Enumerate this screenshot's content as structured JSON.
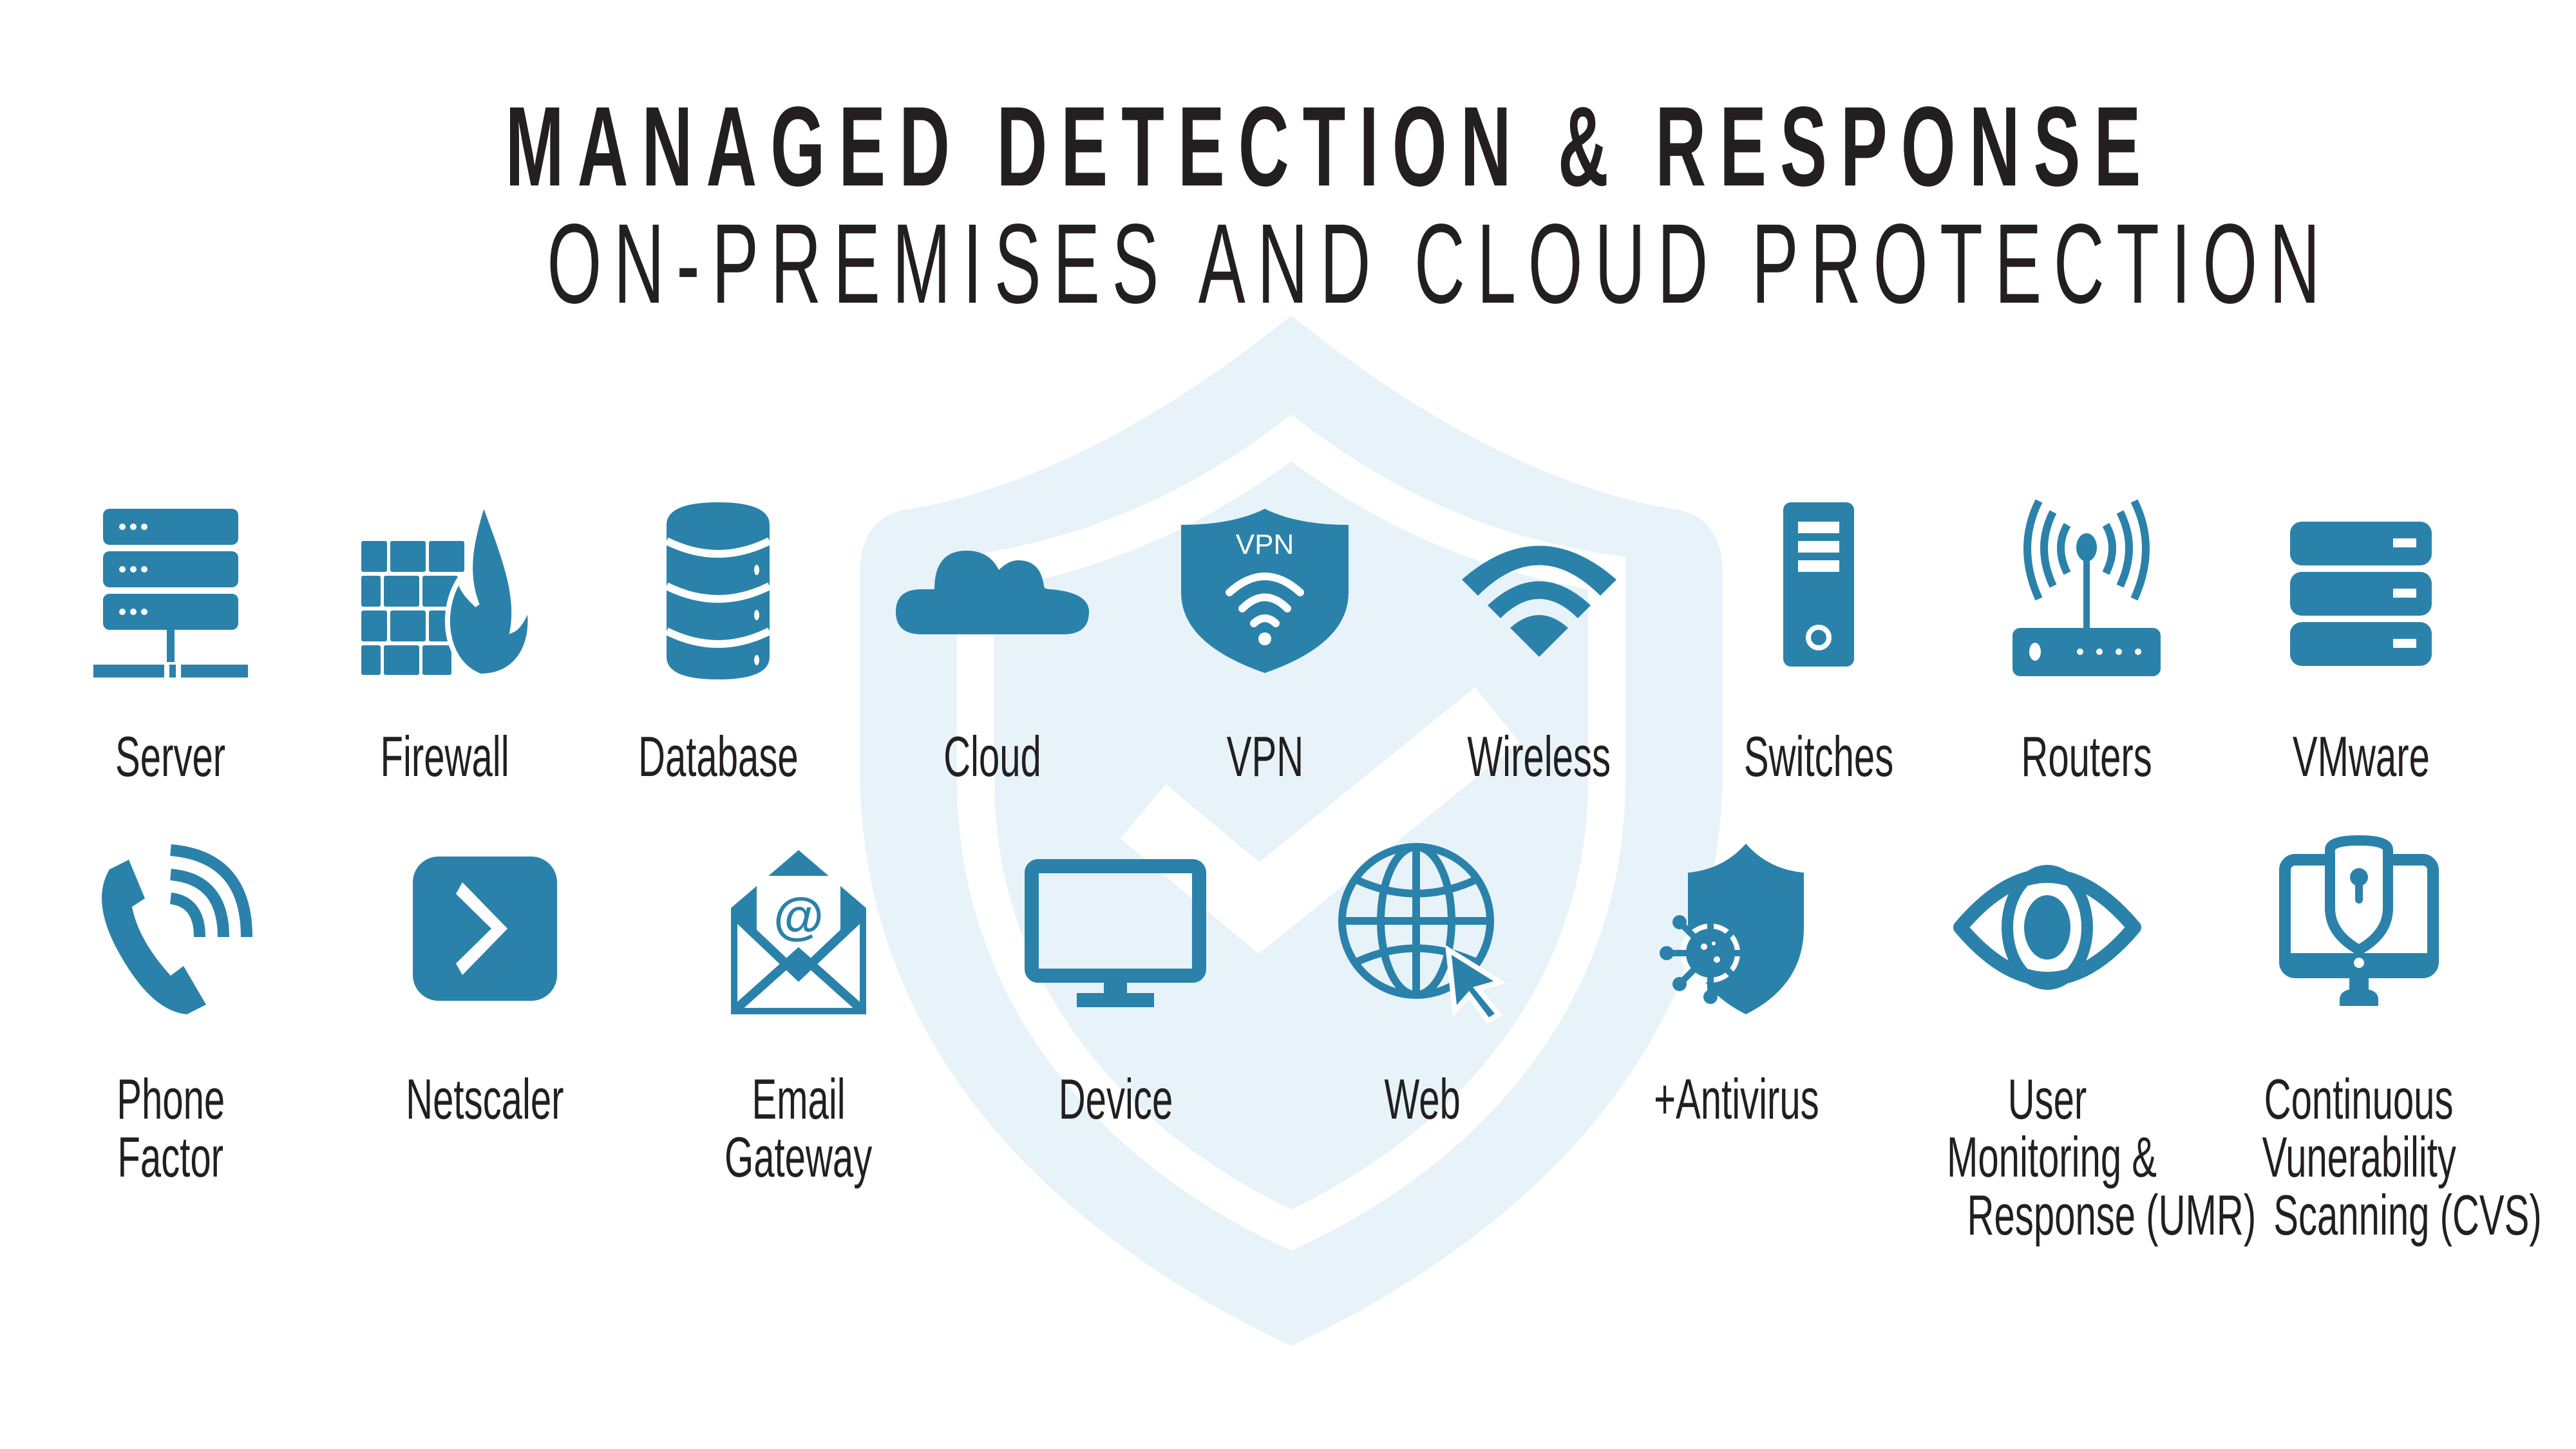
{
  "header": {
    "title": "MANAGED DETECTION & RESPONSE",
    "subtitle": "ON-PREMISES AND CLOUD PROTECTION"
  },
  "colors": {
    "icon": "#2A82AB",
    "watermark": "#E7F3F9",
    "text": "#231F20",
    "background": "#FFFFFF"
  },
  "watermark": {
    "icon": "shield-check-icon"
  },
  "row1": [
    {
      "label": "Server",
      "icon": "server-icon"
    },
    {
      "label": "Firewall",
      "icon": "firewall-icon"
    },
    {
      "label": "Database",
      "icon": "database-icon"
    },
    {
      "label": "Cloud",
      "icon": "cloud-icon"
    },
    {
      "label": "VPN",
      "icon": "vpn-shield-icon",
      "badge": "VPN"
    },
    {
      "label": "Wireless",
      "icon": "wifi-icon"
    },
    {
      "label": "Switches",
      "icon": "switch-tower-icon"
    },
    {
      "label": "Routers",
      "icon": "router-icon"
    },
    {
      "label": "VMware",
      "icon": "server-stack-icon"
    }
  ],
  "row2": [
    {
      "label_lines": [
        "Phone",
        "Factor"
      ],
      "icon": "phone-icon"
    },
    {
      "label_lines": [
        "Netscaler"
      ],
      "icon": "netscaler-chevron-icon"
    },
    {
      "label_lines": [
        "Email",
        "Gateway"
      ],
      "icon": "email-icon",
      "badge": "@"
    },
    {
      "label_lines": [
        "Device"
      ],
      "icon": "monitor-icon"
    },
    {
      "label_lines": [
        "Web"
      ],
      "icon": "globe-cursor-icon"
    },
    {
      "label_lines": [
        "+Antivirus"
      ],
      "icon": "antivirus-shield-icon"
    },
    {
      "label_lines": [
        "User",
        "Monitoring &",
        "Response (UMR)"
      ],
      "icon": "eye-icon"
    },
    {
      "label_lines": [
        "Continuous",
        "Vunerability",
        "Scanning (CVS)"
      ],
      "icon": "monitor-shield-lock-icon"
    }
  ]
}
